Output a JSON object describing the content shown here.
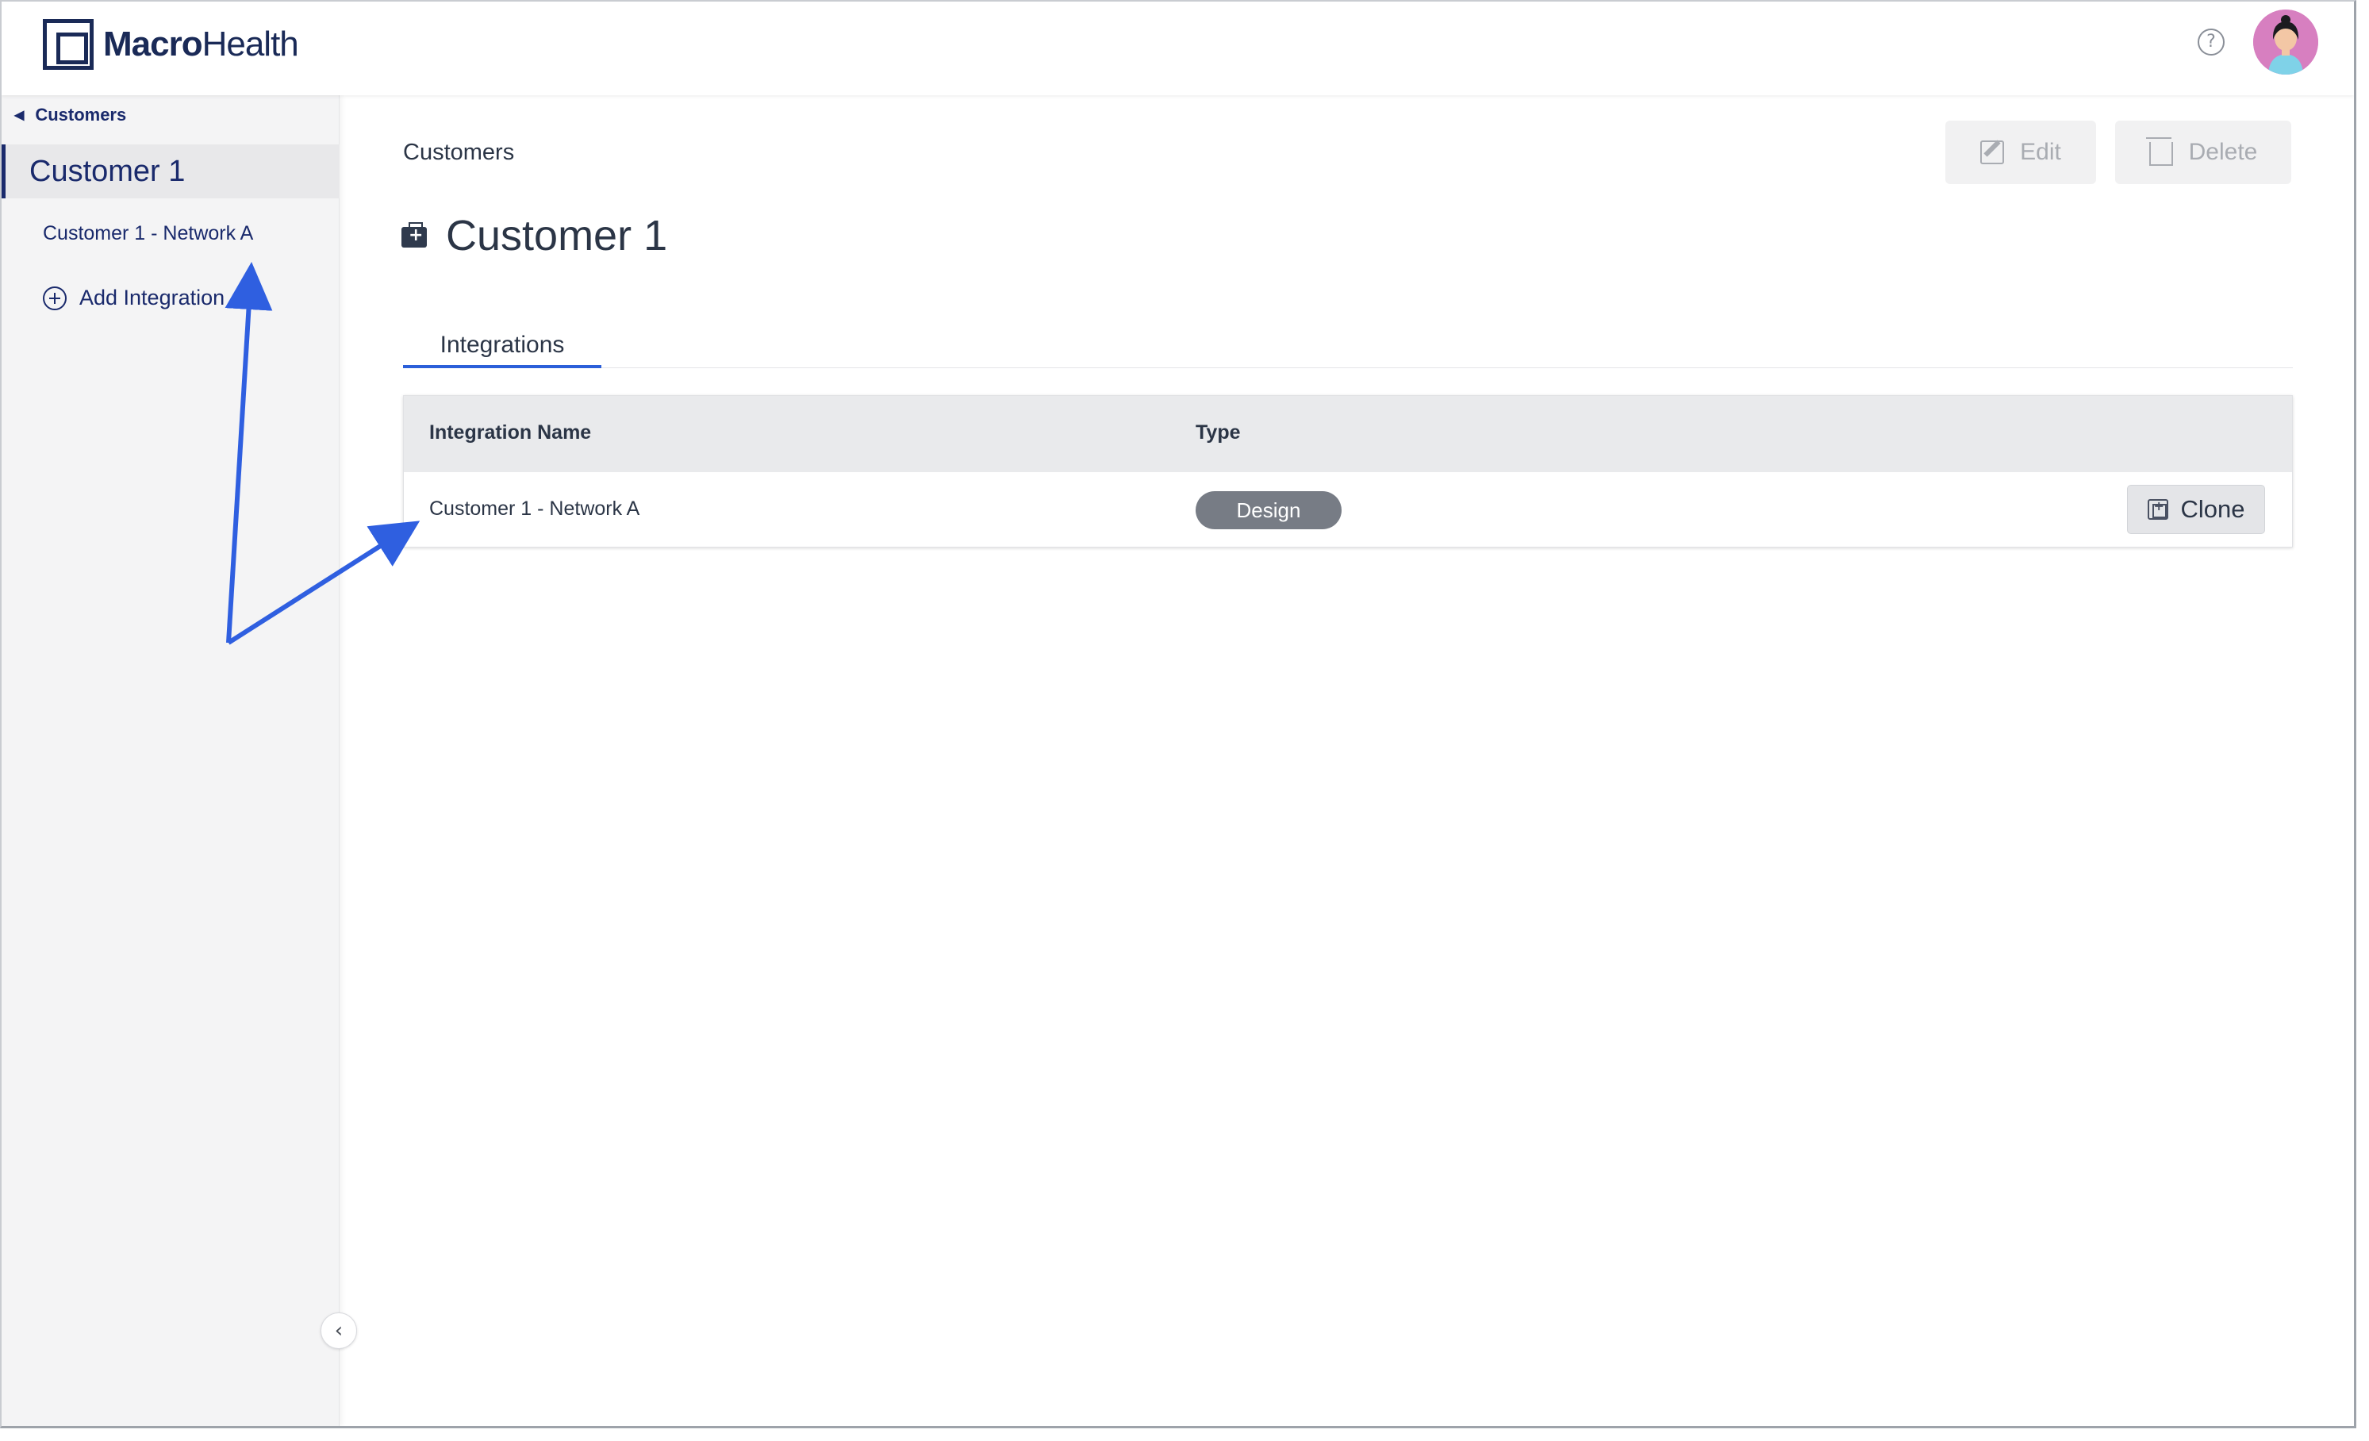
{
  "header": {
    "logo_bold": "Macro",
    "logo_light": "Health",
    "help_symbol": "?"
  },
  "sidebar": {
    "back_label": "Customers",
    "active_item": "Customer 1",
    "items": [
      {
        "label": "Customer 1 - Network A"
      }
    ],
    "add_label": "Add Integration"
  },
  "main": {
    "breadcrumb": "Customers",
    "actions": {
      "edit": "Edit",
      "delete": "Delete"
    },
    "title": "Customer 1",
    "tabs": [
      {
        "label": "Integrations"
      }
    ],
    "table": {
      "headers": [
        "Integration Name",
        "Type"
      ],
      "rows": [
        {
          "name": "Customer 1 - Network A",
          "type": "Design",
          "action": "Clone"
        }
      ]
    }
  },
  "icons": {
    "logo": "macrohealth-logo-icon",
    "help": "help-icon",
    "avatar": "user-avatar",
    "back": "chevron-left-icon",
    "add": "plus-circle-icon",
    "collapse": "chevron-left-icon",
    "edit": "edit-icon",
    "delete": "trash-icon",
    "title": "medical-bag-icon",
    "clone": "clone-icon"
  },
  "colors": {
    "brand": "#1a2a57",
    "accent": "#2b5fd9",
    "annotation": "#2f5fe0",
    "badge": "#777c85"
  }
}
